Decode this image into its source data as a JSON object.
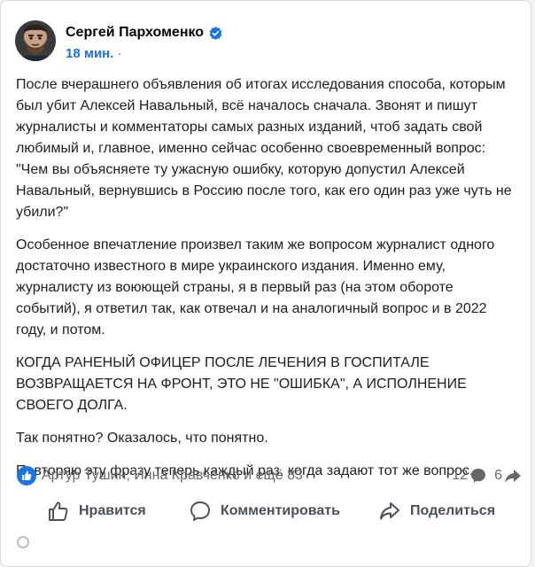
{
  "post": {
    "author": "Сергей Пархоменко",
    "time": "18 мин.",
    "time_sep": "·",
    "paragraphs": [
      "После вчерашнего объявления об итогах исследования способа, которым был убит Алексей Навальный, всё началось сначала. Звонят и пишут журналисты и комментаторы самых разных изданий, чтоб задать свой любимый и, главное, именно сейчас особенно своевременный вопрос: \"Чем вы объясняете ту ужасную ошибку, которую допустил Алексей Навальный, вернувшись в Россию после того, как его один раз уже чуть не убили?\"",
      "Особенное впечатление произвел таким же вопросом журналист одного достаточно известного в мире украинского издания. Именно ему, журналисту из воюющей страны, я в первый раз (на этом обороте событий), я ответил так, как отвечал и на аналогичный вопрос и в 2022 году, и потом.",
      "КОГДА РАНЕНЫЙ ОФИЦЕР ПОСЛЕ ЛЕЧЕНИЯ В ГОСПИТАЛЕ ВОЗВРАЩАЕТСЯ НА ФРОНТ, ЭТО НЕ \"ОШИБКА\", А ИСПОЛНЕНИЕ СВОЕГО ДОЛГА.",
      "Так понятно? Оказалось, что понятно.",
      "Повторяю эту фразу теперь каждый раз, когда задают тот же вопрос."
    ],
    "reactions_text": "Артур Тушин, Инна Кравченко и ещё 83",
    "comments_count": "12",
    "shares_count": "6"
  },
  "actions": {
    "like": "Нравится",
    "comment": "Комментировать",
    "share": "Поделиться"
  },
  "icons": {
    "verified": "verified-badge-icon",
    "like_reaction": "like-reaction-icon",
    "comment": "comment-bubble-icon",
    "share": "share-arrow-icon",
    "like": "thumbs-up-icon",
    "comment_action": "speech-bubble-icon",
    "share_action": "forward-arrow-icon"
  },
  "colors": {
    "link_blue": "#1b74e4",
    "muted": "#65676b",
    "action_text": "#4b4f56"
  }
}
